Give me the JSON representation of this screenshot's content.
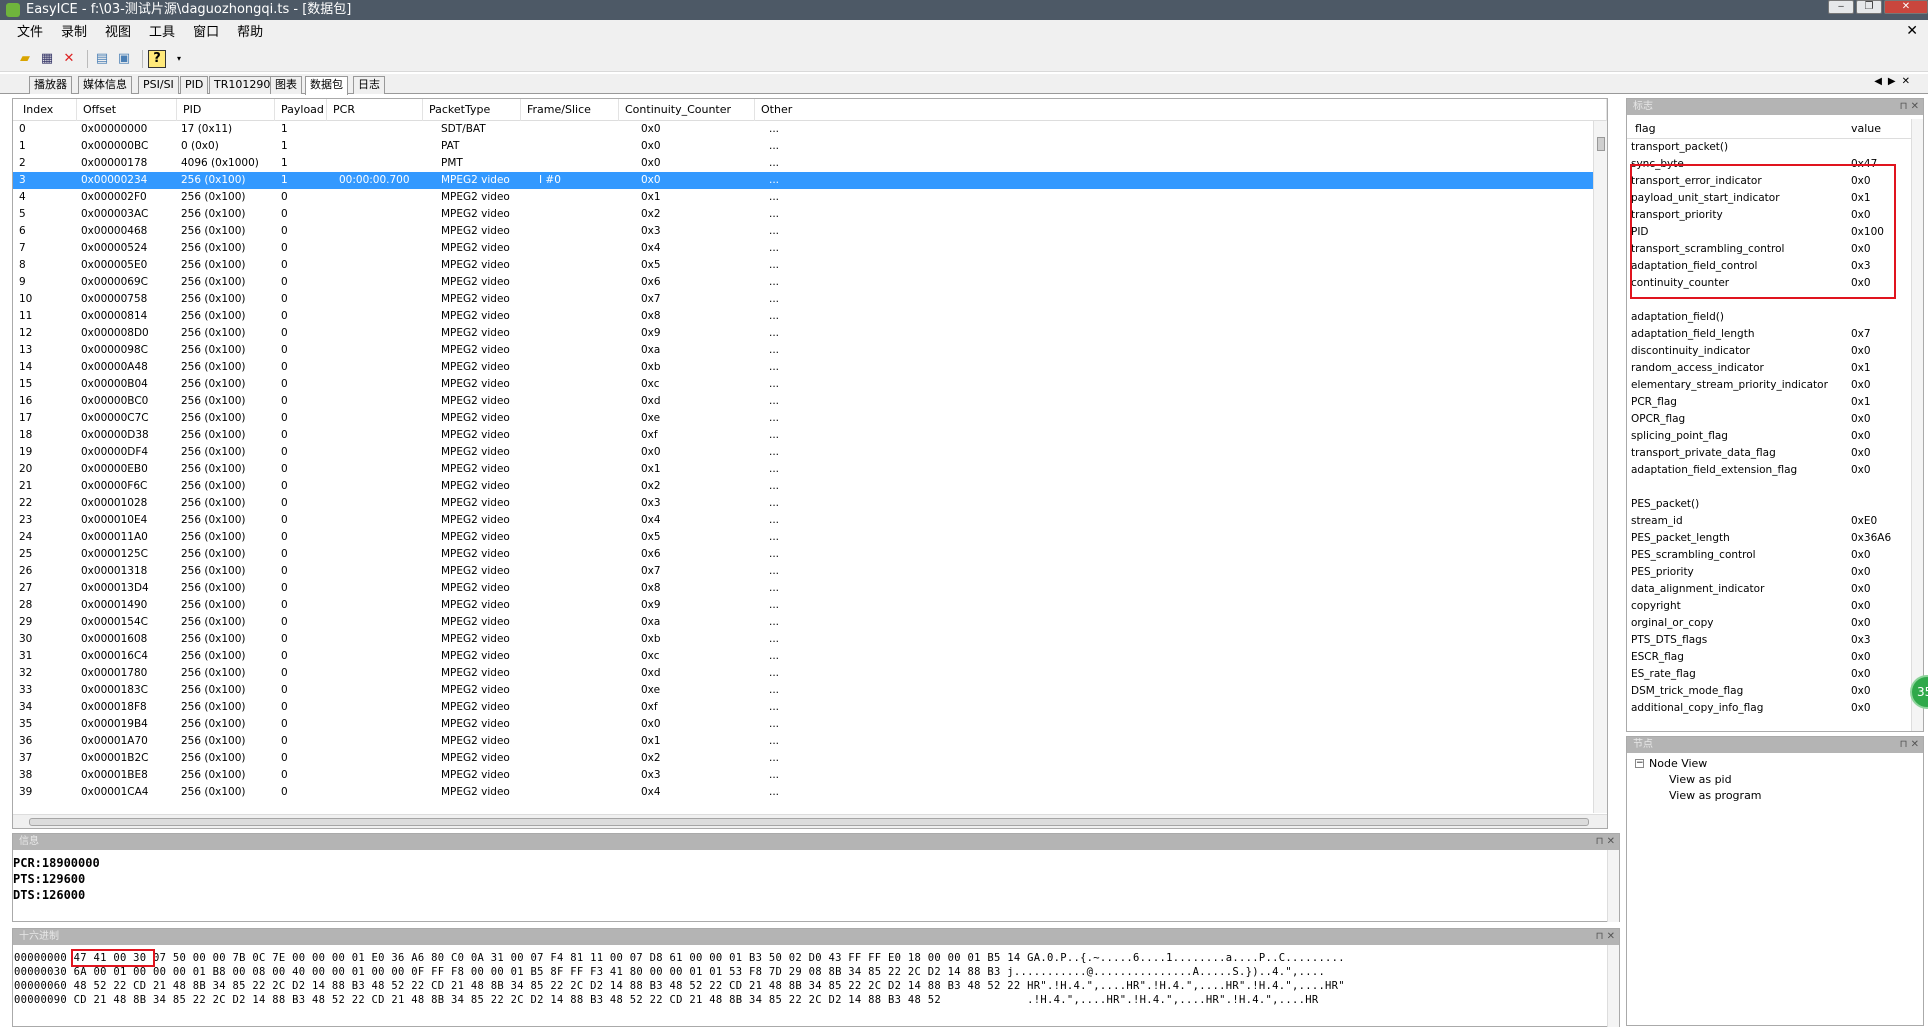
{
  "window": {
    "title": "EasyICE - f:\\03-测试片源\\daguozhongqi.ts - [数据包]"
  },
  "menu": [
    "文件",
    "录制",
    "视图",
    "工具",
    "窗口",
    "帮助"
  ],
  "tabs": [
    "播放器",
    "媒体信息",
    "PSI/SI",
    "PID",
    "TR101290",
    "图表",
    "数据包",
    "日志"
  ],
  "active_tab": "数据包",
  "packets": {
    "columns": [
      "Index",
      "Offset",
      "PID",
      "Payload",
      "PCR",
      "PacketType",
      "Frame/Slice",
      "Continuity_Counter",
      "Other"
    ],
    "rows": [
      [
        "0",
        "0x00000000",
        "17   (0x11)",
        "1",
        "",
        "SDT/BAT",
        "",
        "0x0",
        "..."
      ],
      [
        "1",
        "0x000000BC",
        "0    (0x0)",
        "1",
        "",
        "PAT",
        "",
        "0x0",
        "..."
      ],
      [
        "2",
        "0x00000178",
        "4096   (0x1000)",
        "1",
        "",
        "PMT",
        "",
        "0x0",
        "..."
      ],
      [
        "3",
        "0x00000234",
        "256   (0x100)",
        "1",
        "00:00:00.700",
        "MPEG2 video",
        "I     #0",
        "0x0",
        "..."
      ],
      [
        "4",
        "0x000002F0",
        "256   (0x100)",
        "0",
        "",
        "MPEG2 video",
        "",
        "0x1",
        "..."
      ],
      [
        "5",
        "0x000003AC",
        "256   (0x100)",
        "0",
        "",
        "MPEG2 video",
        "",
        "0x2",
        "..."
      ],
      [
        "6",
        "0x00000468",
        "256   (0x100)",
        "0",
        "",
        "MPEG2 video",
        "",
        "0x3",
        "..."
      ],
      [
        "7",
        "0x00000524",
        "256   (0x100)",
        "0",
        "",
        "MPEG2 video",
        "",
        "0x4",
        "..."
      ],
      [
        "8",
        "0x000005E0",
        "256   (0x100)",
        "0",
        "",
        "MPEG2 video",
        "",
        "0x5",
        "..."
      ],
      [
        "9",
        "0x0000069C",
        "256   (0x100)",
        "0",
        "",
        "MPEG2 video",
        "",
        "0x6",
        "..."
      ],
      [
        "10",
        "0x00000758",
        "256   (0x100)",
        "0",
        "",
        "MPEG2 video",
        "",
        "0x7",
        "..."
      ],
      [
        "11",
        "0x00000814",
        "256   (0x100)",
        "0",
        "",
        "MPEG2 video",
        "",
        "0x8",
        "..."
      ],
      [
        "12",
        "0x000008D0",
        "256   (0x100)",
        "0",
        "",
        "MPEG2 video",
        "",
        "0x9",
        "..."
      ],
      [
        "13",
        "0x0000098C",
        "256   (0x100)",
        "0",
        "",
        "MPEG2 video",
        "",
        "0xa",
        "..."
      ],
      [
        "14",
        "0x00000A48",
        "256   (0x100)",
        "0",
        "",
        "MPEG2 video",
        "",
        "0xb",
        "..."
      ],
      [
        "15",
        "0x00000B04",
        "256   (0x100)",
        "0",
        "",
        "MPEG2 video",
        "",
        "0xc",
        "..."
      ],
      [
        "16",
        "0x00000BC0",
        "256   (0x100)",
        "0",
        "",
        "MPEG2 video",
        "",
        "0xd",
        "..."
      ],
      [
        "17",
        "0x00000C7C",
        "256   (0x100)",
        "0",
        "",
        "MPEG2 video",
        "",
        "0xe",
        "..."
      ],
      [
        "18",
        "0x00000D38",
        "256   (0x100)",
        "0",
        "",
        "MPEG2 video",
        "",
        "0xf",
        "..."
      ],
      [
        "19",
        "0x00000DF4",
        "256   (0x100)",
        "0",
        "",
        "MPEG2 video",
        "",
        "0x0",
        "..."
      ],
      [
        "20",
        "0x00000EB0",
        "256   (0x100)",
        "0",
        "",
        "MPEG2 video",
        "",
        "0x1",
        "..."
      ],
      [
        "21",
        "0x00000F6C",
        "256   (0x100)",
        "0",
        "",
        "MPEG2 video",
        "",
        "0x2",
        "..."
      ],
      [
        "22",
        "0x00001028",
        "256   (0x100)",
        "0",
        "",
        "MPEG2 video",
        "",
        "0x3",
        "..."
      ],
      [
        "23",
        "0x000010E4",
        "256   (0x100)",
        "0",
        "",
        "MPEG2 video",
        "",
        "0x4",
        "..."
      ],
      [
        "24",
        "0x000011A0",
        "256   (0x100)",
        "0",
        "",
        "MPEG2 video",
        "",
        "0x5",
        "..."
      ],
      [
        "25",
        "0x0000125C",
        "256   (0x100)",
        "0",
        "",
        "MPEG2 video",
        "",
        "0x6",
        "..."
      ],
      [
        "26",
        "0x00001318",
        "256   (0x100)",
        "0",
        "",
        "MPEG2 video",
        "",
        "0x7",
        "..."
      ],
      [
        "27",
        "0x000013D4",
        "256   (0x100)",
        "0",
        "",
        "MPEG2 video",
        "",
        "0x8",
        "..."
      ],
      [
        "28",
        "0x00001490",
        "256   (0x100)",
        "0",
        "",
        "MPEG2 video",
        "",
        "0x9",
        "..."
      ],
      [
        "29",
        "0x0000154C",
        "256   (0x100)",
        "0",
        "",
        "MPEG2 video",
        "",
        "0xa",
        "..."
      ],
      [
        "30",
        "0x00001608",
        "256   (0x100)",
        "0",
        "",
        "MPEG2 video",
        "",
        "0xb",
        "..."
      ],
      [
        "31",
        "0x000016C4",
        "256   (0x100)",
        "0",
        "",
        "MPEG2 video",
        "",
        "0xc",
        "..."
      ],
      [
        "32",
        "0x00001780",
        "256   (0x100)",
        "0",
        "",
        "MPEG2 video",
        "",
        "0xd",
        "..."
      ],
      [
        "33",
        "0x0000183C",
        "256   (0x100)",
        "0",
        "",
        "MPEG2 video",
        "",
        "0xe",
        "..."
      ],
      [
        "34",
        "0x000018F8",
        "256   (0x100)",
        "0",
        "",
        "MPEG2 video",
        "",
        "0xf",
        "..."
      ],
      [
        "35",
        "0x000019B4",
        "256   (0x100)",
        "0",
        "",
        "MPEG2 video",
        "",
        "0x0",
        "..."
      ],
      [
        "36",
        "0x00001A70",
        "256   (0x100)",
        "0",
        "",
        "MPEG2 video",
        "",
        "0x1",
        "..."
      ],
      [
        "37",
        "0x00001B2C",
        "256   (0x100)",
        "0",
        "",
        "MPEG2 video",
        "",
        "0x2",
        "..."
      ],
      [
        "38",
        "0x00001BE8",
        "256   (0x100)",
        "0",
        "",
        "MPEG2 video",
        "",
        "0x3",
        "..."
      ],
      [
        "39",
        "0x00001CA4",
        "256   (0x100)",
        "0",
        "",
        "MPEG2 video",
        "",
        "0x4",
        "..."
      ]
    ],
    "selected_index": 3
  },
  "flags_panel": {
    "title": "标志",
    "columns": [
      "flag",
      "value"
    ],
    "rows": [
      [
        "transport_packet()",
        ""
      ],
      [
        "sync_byte",
        "0x47"
      ],
      [
        "transport_error_indicator",
        "0x0"
      ],
      [
        "payload_unit_start_indicator",
        "0x1"
      ],
      [
        "transport_priority",
        "0x0"
      ],
      [
        "PID",
        "0x100"
      ],
      [
        "transport_scrambling_control",
        "0x0"
      ],
      [
        "adaptation_field_control",
        "0x3"
      ],
      [
        "continuity_counter",
        "0x0"
      ],
      [
        "",
        ""
      ],
      [
        "adaptation_field()",
        ""
      ],
      [
        "adaptation_field_length",
        "0x7"
      ],
      [
        "discontinuity_indicator",
        "0x0"
      ],
      [
        "random_access_indicator",
        "0x1"
      ],
      [
        "elementary_stream_priority_indicator",
        "0x0"
      ],
      [
        "PCR_flag",
        "0x1"
      ],
      [
        "OPCR_flag",
        "0x0"
      ],
      [
        "splicing_point_flag",
        "0x0"
      ],
      [
        "transport_private_data_flag",
        "0x0"
      ],
      [
        "adaptation_field_extension_flag",
        "0x0"
      ],
      [
        "",
        ""
      ],
      [
        "PES_packet()",
        ""
      ],
      [
        "stream_id",
        "0xE0"
      ],
      [
        "PES_packet_length",
        "0x36A6"
      ],
      [
        "PES_scrambling_control",
        "0x0"
      ],
      [
        "PES_priority",
        "0x0"
      ],
      [
        "data_alignment_indicator",
        "0x0"
      ],
      [
        "copyright",
        "0x0"
      ],
      [
        "orginal_or_copy",
        "0x0"
      ],
      [
        "PTS_DTS_flags",
        "0x3"
      ],
      [
        "ESCR_flag",
        "0x0"
      ],
      [
        "ES_rate_flag",
        "0x0"
      ],
      [
        "DSM_trick_mode_flag",
        "0x0"
      ],
      [
        "additional_copy_info_flag",
        "0x0"
      ]
    ]
  },
  "node_panel": {
    "title": "节点",
    "root": "Node View",
    "children": [
      "View as pid",
      "View as program"
    ]
  },
  "info_panel": {
    "title": "信息",
    "lines": [
      "PCR:18900000",
      "PTS:129600",
      "DTS:126000"
    ]
  },
  "hex_panel": {
    "title": "十六进制",
    "lines": [
      "00000000 47 41 00 30 07 50 00 00 7B 0C 7E 00 00 00 01 E0 36 A6 80 C0 0A 31 00 07 F4 81 11 00 07 D8 61 00 00 01 B3 50 02 D0 43 FF FF E0 18 00 00 01 B5 14 GA.0.P..{.~.....6....1........a....P..C.........",
      "00000030 6A 00 01 00 00 00 01 B8 00 08 00 40 00 00 01 00 00 0F FF F8 00 00 01 B5 8F FF F3 41 80 00 00 01 01 53 F8 7D 29 08 8B 34 85 22 2C D2 14 88 B3 j...........@...............A.....S.})..4.\",....",
      "00000060 48 52 22 CD 21 48 8B 34 85 22 2C D2 14 88 B3 48 52 22 CD 21 48 8B 34 85 22 2C D2 14 88 B3 48 52 22 CD 21 48 8B 34 85 22 2C D2 14 88 B3 48 52 22 HR\".!H.4.\",....HR\".!H.4.\",....HR\".!H.4.\",....HR\"",
      "00000090 CD 21 48 8B 34 85 22 2C D2 14 88 B3 48 52 22 CD 21 48 8B 34 85 22 2C D2 14 88 B3 48 52 22 CD 21 48 8B 34 85 22 2C D2 14 88 B3 48 52             .!H.4.\",....HR\".!H.4.\",....HR\".!H.4.\",....HR"
    ]
  },
  "badge": {
    "text": "35"
  },
  "colors": {
    "selection": "#3399ff",
    "highlight_box": "#e0141e",
    "titlebar": "#4d5966",
    "panel_header": "#b4b4b4"
  }
}
